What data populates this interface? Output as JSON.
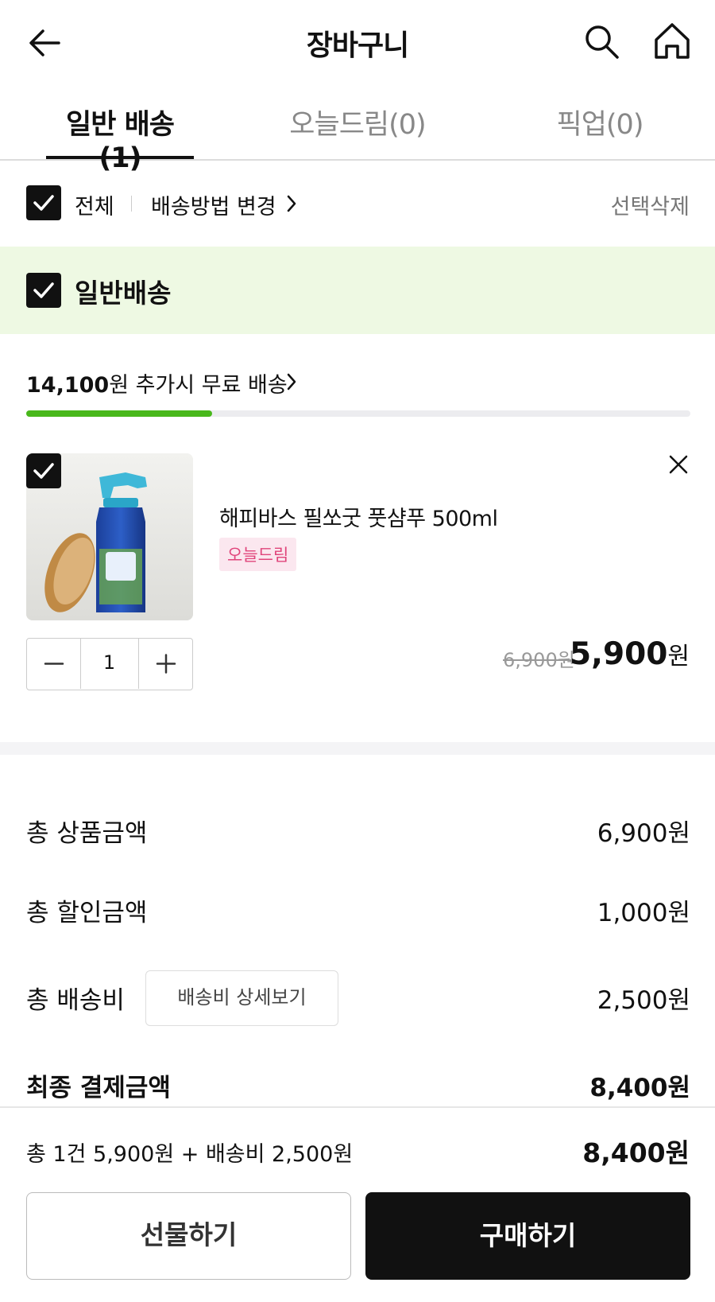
{
  "header": {
    "title": "장바구니",
    "back_icon": "arrow-left-icon",
    "search_icon": "search-icon",
    "home_icon": "home-icon"
  },
  "tabs": [
    {
      "label": "일반 배송(1)",
      "active": true
    },
    {
      "label": "오늘드림(0)",
      "active": false
    },
    {
      "label": "픽업(0)",
      "active": false
    }
  ],
  "select_bar": {
    "all_label": "전체",
    "all_checked": true,
    "change_method": "배송방법 변경",
    "delete_selected": "선택삭제"
  },
  "group": {
    "label": "일반배송",
    "checked": true
  },
  "free_shipping": {
    "amount": "14,100",
    "text": "원 추가시 무료 배송",
    "progress_fraction": 0.28
  },
  "product": {
    "checked": true,
    "name": "해피바스 필쏘굿 풋샴푸 500ml",
    "badge": "오늘드림",
    "quantity": "1",
    "original_price": "6,900원",
    "price": "5,900",
    "price_unit": "원"
  },
  "summary": {
    "total_product_label": "총 상품금액",
    "total_product_value": "6,900원",
    "total_discount_label": "총 할인금액",
    "total_discount_value": "1,000원",
    "total_shipping_label": "총 배송비",
    "shipping_detail_button": "배송비 상세보기",
    "total_shipping_value": "2,500원",
    "final_label": "최종 결제금액",
    "final_value": "8,400원"
  },
  "footer": {
    "summary_text": "총 1건 5,900원 + 배송비 2,500원",
    "total": "8,400원",
    "gift_button": "선물하기",
    "buy_button": "구매하기"
  },
  "colors": {
    "accent_green": "#48b81b",
    "group_bg": "#eef9e3",
    "badge_text": "#e0457b",
    "badge_bg": "#fbe7ef"
  }
}
